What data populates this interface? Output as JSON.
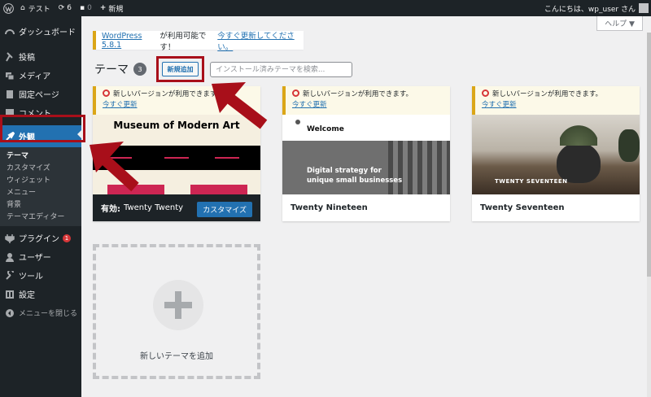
{
  "adminbar": {
    "site_name": "テスト",
    "updates_count": "6",
    "comments_count": "0",
    "new_label": "新規",
    "greeting": "こんにちは、wp_user さん"
  },
  "sidebar": {
    "dashboard": "ダッシュボード",
    "posts": "投稿",
    "media": "メディア",
    "pages": "固定ページ",
    "comments": "コメント",
    "appearance": "外観",
    "submenu": [
      "テーマ",
      "カスタマイズ",
      "ウィジェット",
      "メニュー",
      "背景",
      "テーマエディター"
    ],
    "plugins": "プラグイン",
    "plugins_badge": "1",
    "users": "ユーザー",
    "tools": "ツール",
    "settings": "設定",
    "collapse": "メニューを閉じる"
  },
  "help": "ヘルプ ▼",
  "notice": {
    "version_link": "WordPress 5.8.1",
    "text": " が利用可能です！",
    "update_link": "今すぐ更新してください。"
  },
  "page": {
    "title": "テーマ",
    "count": "3",
    "add_new": "新規追加",
    "search_placeholder": "インストール済みテーマを検索..."
  },
  "themes": [
    {
      "update_text": "新しいバージョンが利用できます。",
      "update_link": "今すぐ更新",
      "shot_title": "Museum of Modern Art",
      "active_label": "有効:",
      "name": "Twenty Twenty",
      "customize": "カスタマイズ"
    },
    {
      "update_text": "新しいバージョンが利用できます。",
      "update_link": "今すぐ更新",
      "shot_title": "Welcome",
      "shot_body": [
        "Digital strategy for",
        "unique small businesses"
      ],
      "name": "Twenty Nineteen"
    },
    {
      "update_text": "新しいバージョンが利用できます。",
      "update_link": "今すぐ更新",
      "shot_title": "TWENTY SEVENTEEN",
      "name": "Twenty Seventeen"
    }
  ],
  "add_theme_label": "新しいテーマを追加",
  "colors": {
    "adminbar": "#1d2327",
    "accent": "#2271b1",
    "warning": "#dba617",
    "annotation_red": "#a80f1a"
  }
}
